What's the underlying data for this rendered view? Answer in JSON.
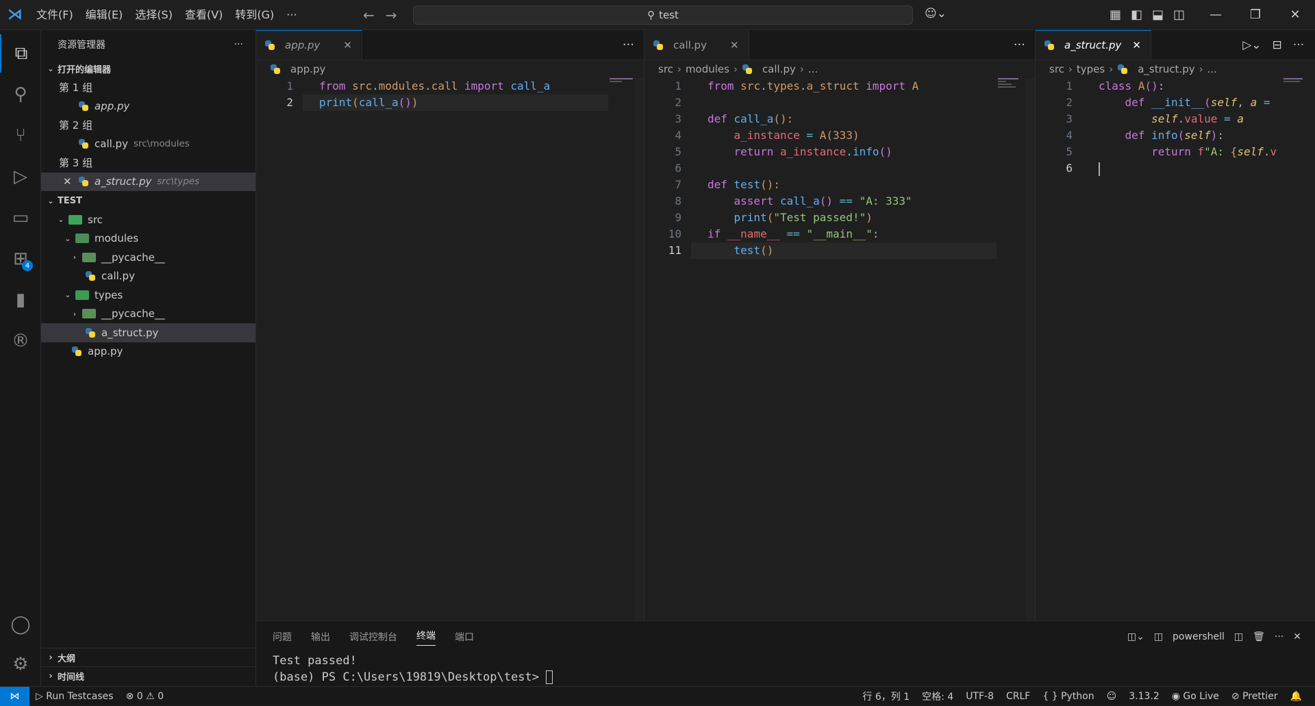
{
  "titlebar": {
    "menu": [
      "文件(F)",
      "编辑(E)",
      "选择(S)",
      "查看(V)",
      "转到(G)",
      "···"
    ],
    "search": "test"
  },
  "activity": {
    "extensions_badge": "4"
  },
  "sidebar": {
    "title": "资源管理器",
    "open_editors_header": "打开的编辑器",
    "groups": [
      {
        "label": "第 1 组",
        "file": "app.py",
        "path": ""
      },
      {
        "label": "第 2 组",
        "file": "call.py",
        "path": "src\\modules"
      },
      {
        "label": "第 3 组",
        "file": "a_struct.py",
        "path": "src\\types"
      }
    ],
    "workspace_header": "TEST",
    "tree": {
      "src": "src",
      "modules": "modules",
      "pycache1": "__pycache__",
      "call": "call.py",
      "types": "types",
      "pycache2": "__pycache__",
      "a_struct": "a_struct.py",
      "app": "app.py"
    },
    "outline": "大纲",
    "timeline": "时间线"
  },
  "editor1": {
    "tab": "app.py",
    "breadcrumb": "app.py"
  },
  "editor2": {
    "tab": "call.py",
    "crumb1": "src",
    "crumb2": "modules",
    "crumb3": "call.py",
    "crumb4": "..."
  },
  "editor3": {
    "tab": "a_struct.py",
    "crumb1": "src",
    "crumb2": "types",
    "crumb3": "a_struct.py",
    "crumb4": "..."
  },
  "panel": {
    "tabs": [
      "问题",
      "输出",
      "调试控制台",
      "终端",
      "端口"
    ],
    "shell": "powershell",
    "terminal_lines": [
      "Test passed!",
      "(base) PS C:\\Users\\19819\\Desktop\\test> "
    ]
  },
  "statusbar": {
    "run": "Run Testcases",
    "errors": "0",
    "warnings": "0",
    "position": "行 6，列 1",
    "spaces": "空格: 4",
    "encoding": "UTF-8",
    "eol": "CRLF",
    "language": "Python",
    "version": "3.13.2",
    "golive": "Go Live",
    "prettier": "Prettier"
  }
}
